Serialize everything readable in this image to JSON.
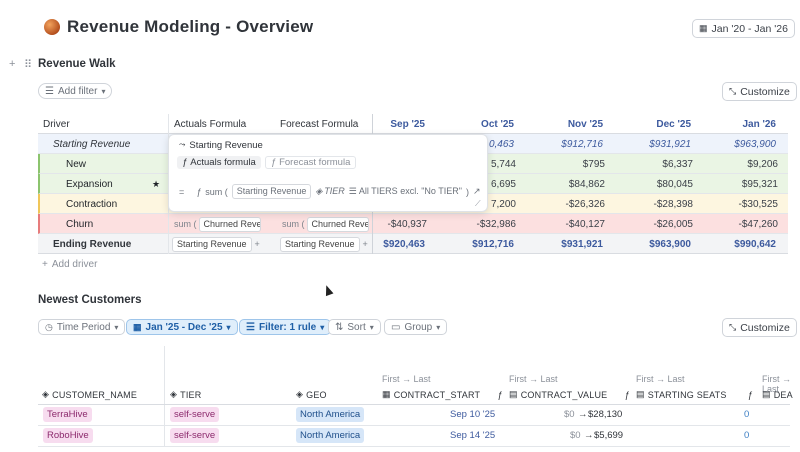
{
  "header": {
    "title": "Revenue Modeling - Overview",
    "date_range": "Jan '20 - Jan '26"
  },
  "revenue_walk": {
    "title": "Revenue Walk",
    "add_filter": "Add filter",
    "customize": "Customize",
    "add_driver": "Add driver",
    "columns": [
      "Driver",
      "Actuals Formula",
      "Forecast Formula",
      "Sep '25",
      "Oct '25",
      "Nov '25",
      "Dec '25",
      "Jan '26"
    ],
    "rows": [
      {
        "driver": "Starting Revenue",
        "values": [
          "",
          "0,463",
          "$912,716",
          "$931,921",
          "$963,900"
        ]
      },
      {
        "driver": "New",
        "values": [
          "",
          "5,744",
          "$795",
          "$6,337",
          "$9,206"
        ]
      },
      {
        "driver": "Expansion",
        "star": "★",
        "values": [
          "",
          "6,695",
          "$84,862",
          "$80,045",
          "$95,321"
        ]
      },
      {
        "driver": "Contraction",
        "values": [
          "",
          "7,200",
          "-$26,326",
          "-$28,398",
          "-$30,525"
        ]
      },
      {
        "driver": "Churn",
        "actuals_prefix": "sum (",
        "actuals_chip": "Churned Revenu",
        "forecast_prefix": "sum (",
        "forecast_chip": "Churned Rever",
        "values": [
          "-$40,937",
          "-$32,986",
          "-$40,127",
          "-$26,005",
          "-$47,260"
        ]
      },
      {
        "driver": "Ending Revenue",
        "actuals_chip": "Starting Revenue",
        "actuals_extra": "+",
        "forecast_chip": "Starting Revenue",
        "forecast_extra": "+",
        "values": [
          "$920,463",
          "$912,716",
          "$931,921",
          "$963,900",
          "$990,642"
        ]
      }
    ],
    "popup": {
      "title": "Starting Revenue",
      "tab_actuals": "Actuals formula",
      "tab_forecast": "Forecast formula",
      "eq": "=",
      "fx": "sum (",
      "chip_driver": "Starting Revenue",
      "chip_dim": "TIER",
      "chip_filter": "All TIERS excl. \"No TIER\"",
      "close_paren": ")"
    }
  },
  "newest_customers": {
    "title": "Newest Customers",
    "filters": {
      "time_period": "Time Period",
      "date": "Jan '25 - Dec '25",
      "filter": "Filter: 1 rule",
      "sort": "Sort",
      "group": "Group"
    },
    "customize": "Customize",
    "first_last": "First → Last",
    "columns": [
      "CUSTOMER_NAME",
      "TIER",
      "GEO",
      "CONTRACT_START",
      "CONTRACT_VALUE",
      "STARTING SEATS",
      "DEA"
    ],
    "rows": [
      {
        "name": "TerraHive",
        "tier": "self-serve",
        "geo": "North America",
        "start": "Sep 10 '25",
        "value_from": "$0",
        "value_to": "$28,130",
        "seats": "0"
      },
      {
        "name": "RoboHive",
        "tier": "self-serve",
        "geo": "North America",
        "start": "Sep 14 '25",
        "value_from": "$0",
        "value_to": "$5,699",
        "seats": "0"
      }
    ]
  },
  "colors": {
    "accent": "#3d5a9e",
    "new_row": "#eaf5e4",
    "contraction_row": "#fdf6e0",
    "churn_row": "#fce0e0",
    "starting_row": "#eef3fb"
  }
}
